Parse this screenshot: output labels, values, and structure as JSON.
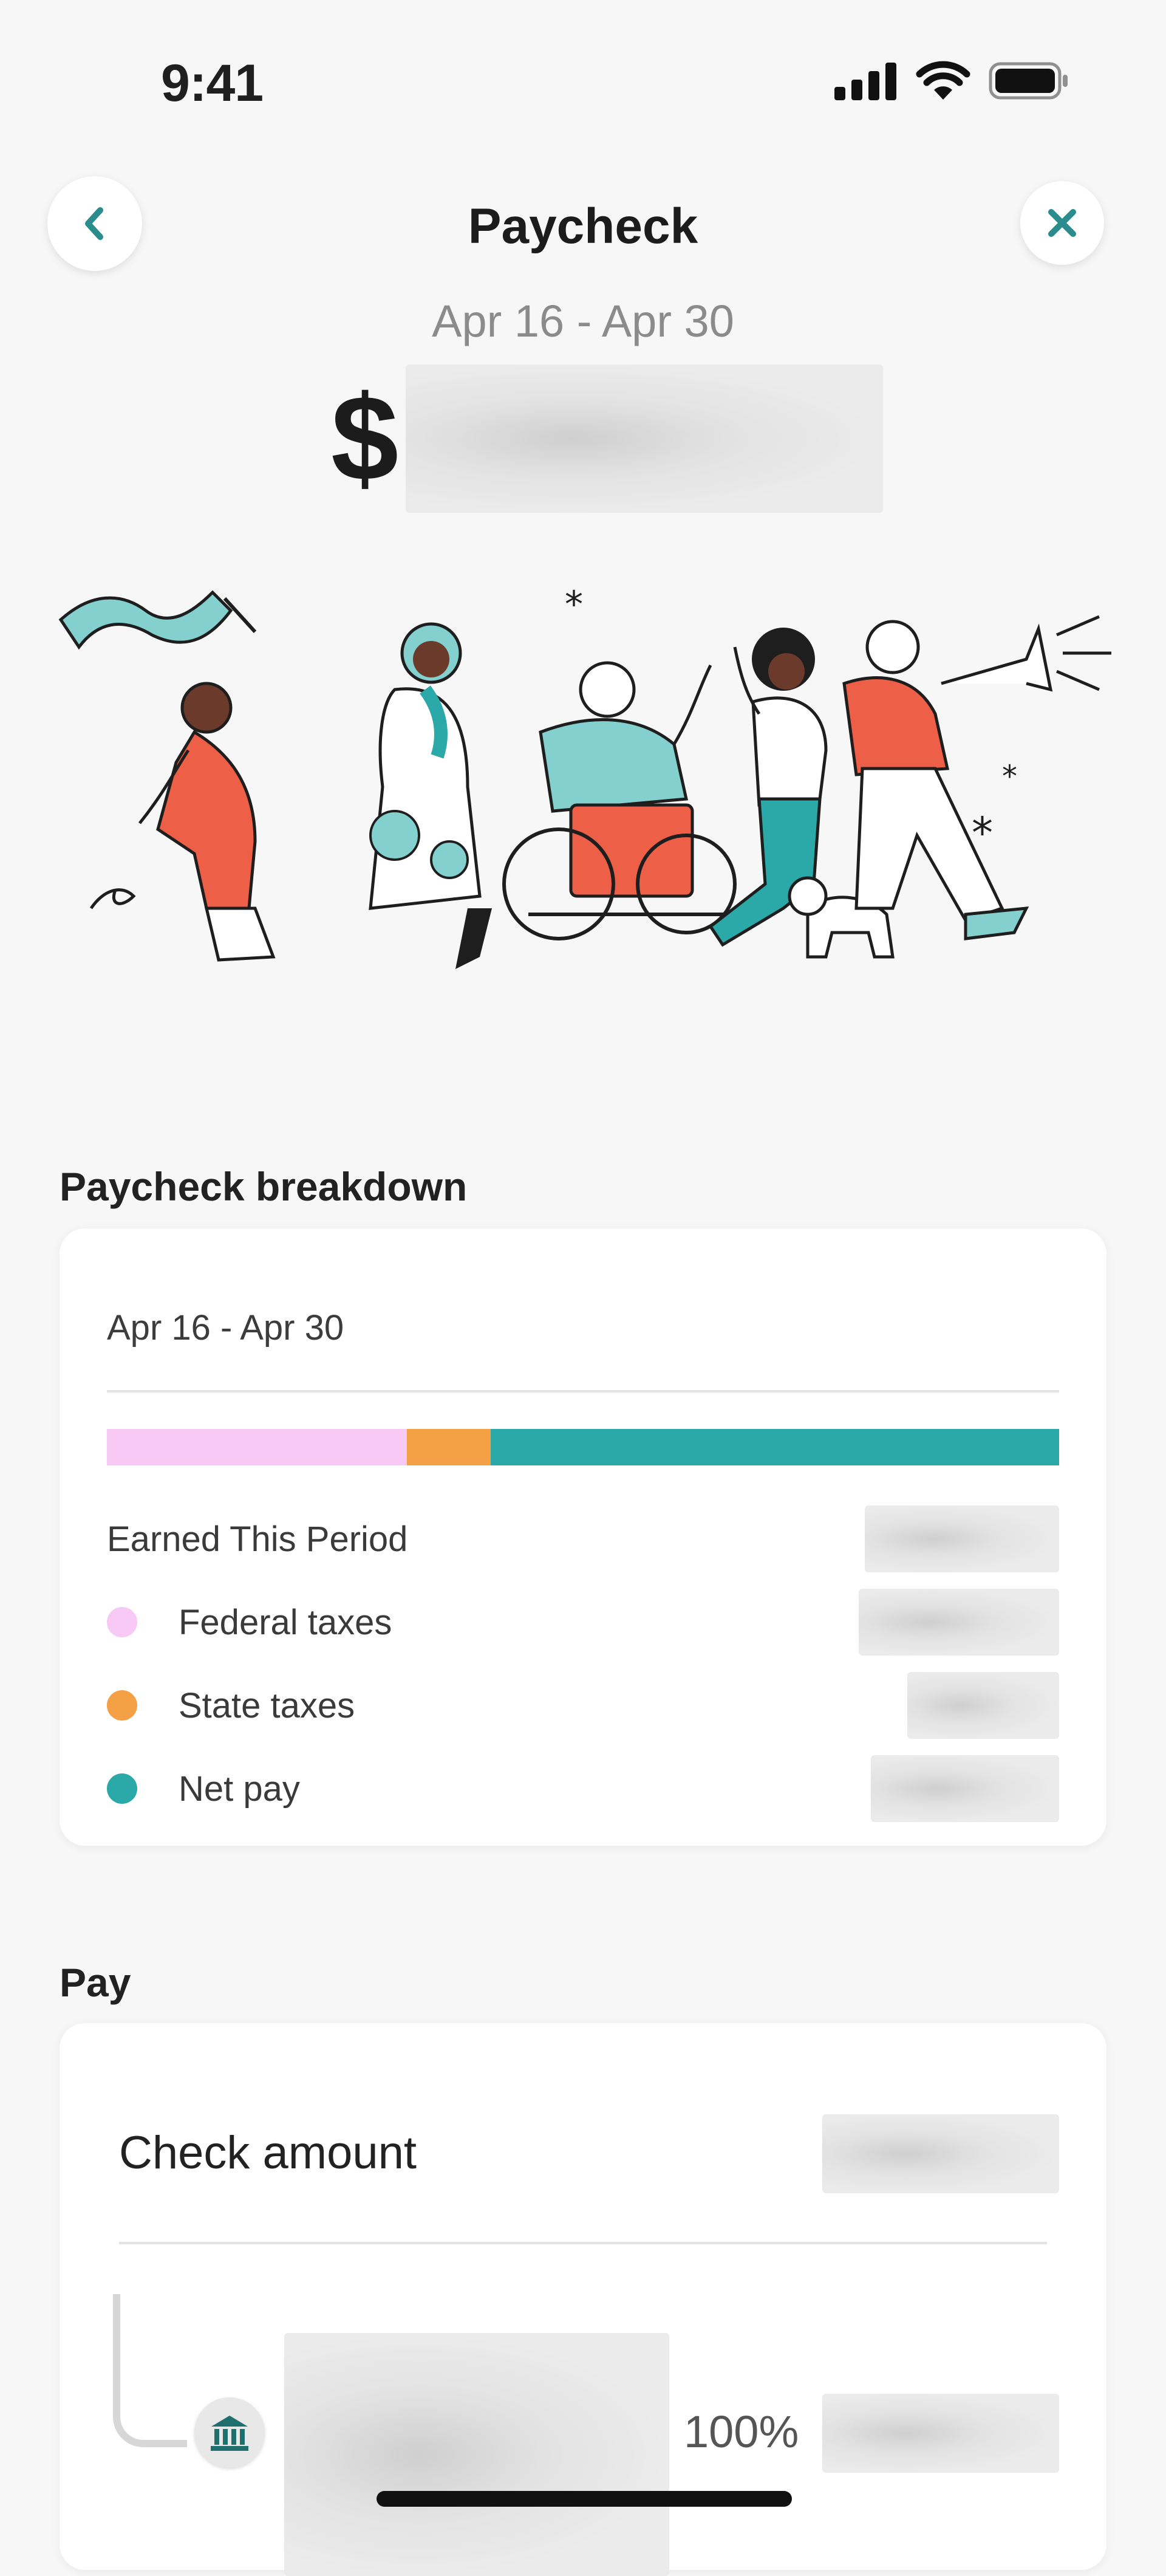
{
  "status_bar": {
    "time": "9:41"
  },
  "header": {
    "title": "Paycheck",
    "back_icon": "chevron-left-icon",
    "close_icon": "close-icon"
  },
  "paycheck": {
    "period": "Apr 16 - Apr 30",
    "currency_symbol": "$",
    "amount": ""
  },
  "breakdown": {
    "section_title": "Paycheck breakdown",
    "period": "Apr 16 - Apr 30",
    "bar_segments": [
      {
        "name": "Federal taxes",
        "color": "#f9c9f6",
        "fraction": 0.315
      },
      {
        "name": "State taxes",
        "color": "#f4a045",
        "fraction": 0.088
      },
      {
        "name": "Net pay",
        "color": "#2ba8a8",
        "fraction": 0.597
      }
    ],
    "earned_label": "Earned This Period",
    "earned_value": "",
    "items": [
      {
        "label": "Federal taxes",
        "color": "#f9c9f6",
        "value": ""
      },
      {
        "label": "State taxes",
        "color": "#f4a045",
        "value": ""
      },
      {
        "label": "Net pay",
        "color": "#2ba8a8",
        "value": ""
      }
    ]
  },
  "pay": {
    "section_title": "Pay",
    "check_amount_label": "Check amount",
    "check_amount_value": "",
    "allocation": {
      "icon": "bank-icon",
      "account": "",
      "percent": "100%",
      "amount": ""
    }
  },
  "colors": {
    "accent": "#2a8c8c",
    "background": "#f7f7f7"
  }
}
